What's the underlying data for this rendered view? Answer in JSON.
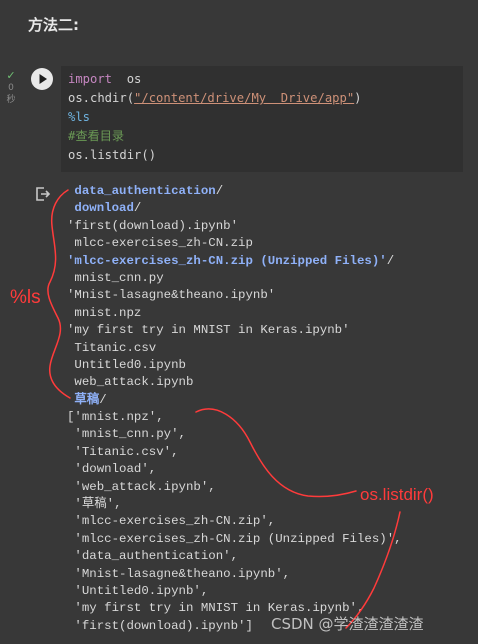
{
  "heading": "方法二:",
  "cell": {
    "status_check": "✓",
    "status_time": "0",
    "status_unit": "秒",
    "code": {
      "line1_kw": "import",
      "line1_rest": "  os",
      "line2_pre": "os.chdir(",
      "line2_str": "\"/content/drive/My  Drive/app\"",
      "line2_post": ")",
      "line3": "%ls",
      "line4": "#查看目录",
      "line5": "os.listdir()"
    }
  },
  "output": {
    "ls": [
      {
        "text": " data_authentication",
        "suffix": "/",
        "style": "dir"
      },
      {
        "text": " download",
        "suffix": "/",
        "style": "dir"
      },
      {
        "text": "'first(download).ipynb'",
        "suffix": "",
        "style": "plain"
      },
      {
        "text": " mlcc-exercises_zh-CN.zip",
        "suffix": "",
        "style": "plain"
      },
      {
        "text": "'mlcc-exercises_zh-CN.zip (Unzipped Files)'",
        "suffix": "/",
        "style": "dir"
      },
      {
        "text": " mnist_cnn.py",
        "suffix": "",
        "style": "plain"
      },
      {
        "text": "'Mnist-lasagne&theano.ipynb'",
        "suffix": "",
        "style": "plain"
      },
      {
        "text": " mnist.npz",
        "suffix": "",
        "style": "plain"
      },
      {
        "text": "'my first try in MNIST in Keras.ipynb'",
        "suffix": "",
        "style": "plain"
      },
      {
        "text": " Titanic.csv",
        "suffix": "",
        "style": "plain"
      },
      {
        "text": " Untitled0.ipynb",
        "suffix": "",
        "style": "plain"
      },
      {
        "text": " web_attack.ipynb",
        "suffix": "",
        "style": "plain"
      },
      {
        "text": " 草稿",
        "suffix": "/",
        "style": "dir"
      }
    ],
    "listdir": [
      "['mnist.npz',",
      " 'mnist_cnn.py',",
      " 'Titanic.csv',",
      " 'download',",
      " 'web_attack.ipynb',",
      " '草稿',",
      " 'mlcc-exercises_zh-CN.zip',",
      " 'mlcc-exercises_zh-CN.zip (Unzipped Files)',",
      " 'data_authentication',",
      " 'Mnist-lasagne&theano.ipynb',",
      " 'Untitled0.ipynb',",
      " 'my first try in MNIST in Keras.ipynb',",
      " 'first(download).ipynb']"
    ]
  },
  "annotations": {
    "ls_label": "%ls",
    "listdir_label": "os.listdir()",
    "color": "#ff3b3b"
  },
  "watermark": "CSDN @学渣渣渣渣渣",
  "icons": {
    "run": "play-icon",
    "output": "output-arrow-icon"
  }
}
